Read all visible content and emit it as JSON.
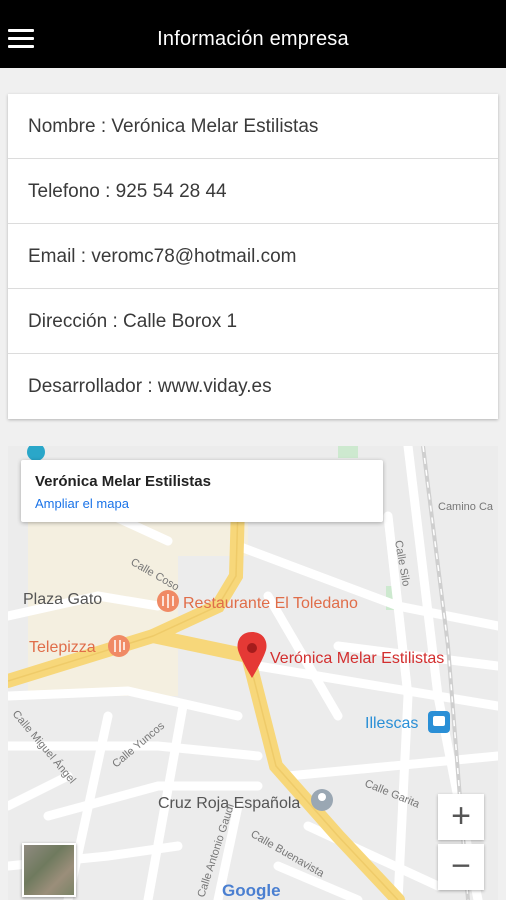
{
  "header": {
    "title": "Información empresa",
    "menu_icon": "hamburger-menu-icon"
  },
  "info": {
    "nombre": "Nombre : Verónica Melar Estilistas",
    "telefono": "Telefono : 925 54 28 44",
    "email": "Email : veromc78@hotmail.com",
    "direccion": "Dirección : Calle Borox 1",
    "desarrollador": "Desarrollador : www.viday.es"
  },
  "map": {
    "info_title": "Verónica Melar Estilistas",
    "info_link": "Ampliar el mapa",
    "marker_label": "Verónica Melar Estilistas",
    "places": {
      "plaza_gato": "Plaza Gato",
      "restaurante": "Restaurante El Toledano",
      "telepizza": "Telepizza",
      "illescas": "Illescas",
      "cruz_roja": "Cruz Roja Española"
    },
    "streets": {
      "camino": "Camino Ca",
      "silo": "Calle Silo",
      "coso": "Calle Coso",
      "miguel_angel": "Calle Miguel Ángel",
      "yuncos": "Calle Yuncos",
      "garita": "Calle Garita",
      "buenavista": "Calle Buenavista",
      "gaudi": "Calle Antonio Gaudí"
    },
    "logo": "Google",
    "zoom_in": "+",
    "zoom_out": "−",
    "colors": {
      "main_road": "#f7d77a",
      "marker": "#e53935",
      "marker_text": "#d32f2f",
      "poi": "#f08a65",
      "link": "#1a73e8",
      "transit": "#2a8fd6"
    }
  }
}
